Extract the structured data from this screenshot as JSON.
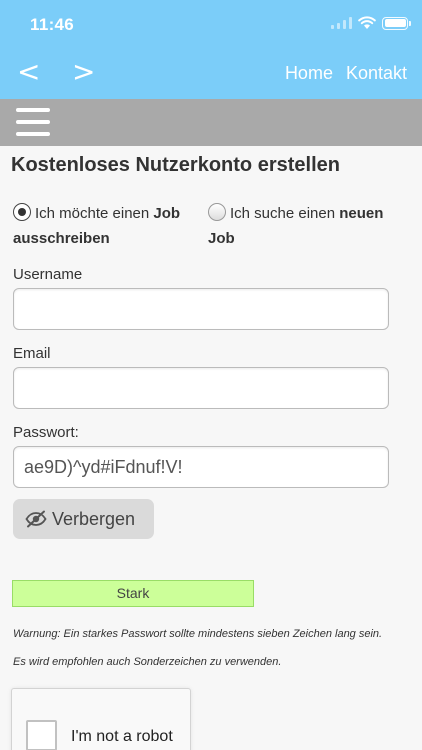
{
  "status_bar": {
    "time": "11:46",
    "icons": [
      "signal-icon",
      "wifi-icon",
      "battery-icon"
    ]
  },
  "nav": {
    "back_glyph": "<",
    "forward_glyph": ">",
    "links": [
      "Home",
      "Kontakt"
    ]
  },
  "menu": {
    "icon": "hamburger-menu-icon"
  },
  "form": {
    "title": "Kostenloses Nutzerkonto erstellen",
    "radio_options": [
      {
        "prefix": "Ich möchte einen ",
        "bold": "Job",
        "line2": "ausschreiben",
        "selected": true
      },
      {
        "prefix": "Ich suche einen ",
        "bold": "neuen",
        "line2": "Job",
        "selected": false
      }
    ],
    "username": {
      "label": "Username",
      "value": "",
      "placeholder": ""
    },
    "email": {
      "label": "Email",
      "value": "",
      "placeholder": ""
    },
    "password": {
      "label": "Passwort:",
      "value": "ae9D)^yd#iFdnuf!V!"
    },
    "toggle_button": {
      "label": "Verbergen",
      "icon": "eye-slash-icon"
    },
    "strength": {
      "label": "Stark"
    },
    "warning": "Warnung: Ein starkes Passwort sollte mindestens sieben Zeichen lang sein.",
    "recommendation": "Es wird empfohlen auch Sonderzeichen zu verwenden.",
    "captcha": {
      "label": "I'm not a robot",
      "checked": false
    }
  },
  "colors": {
    "header": "#7bcdf9",
    "menu_bar": "#a9a9a9",
    "strength_bg": "#ccff99"
  }
}
